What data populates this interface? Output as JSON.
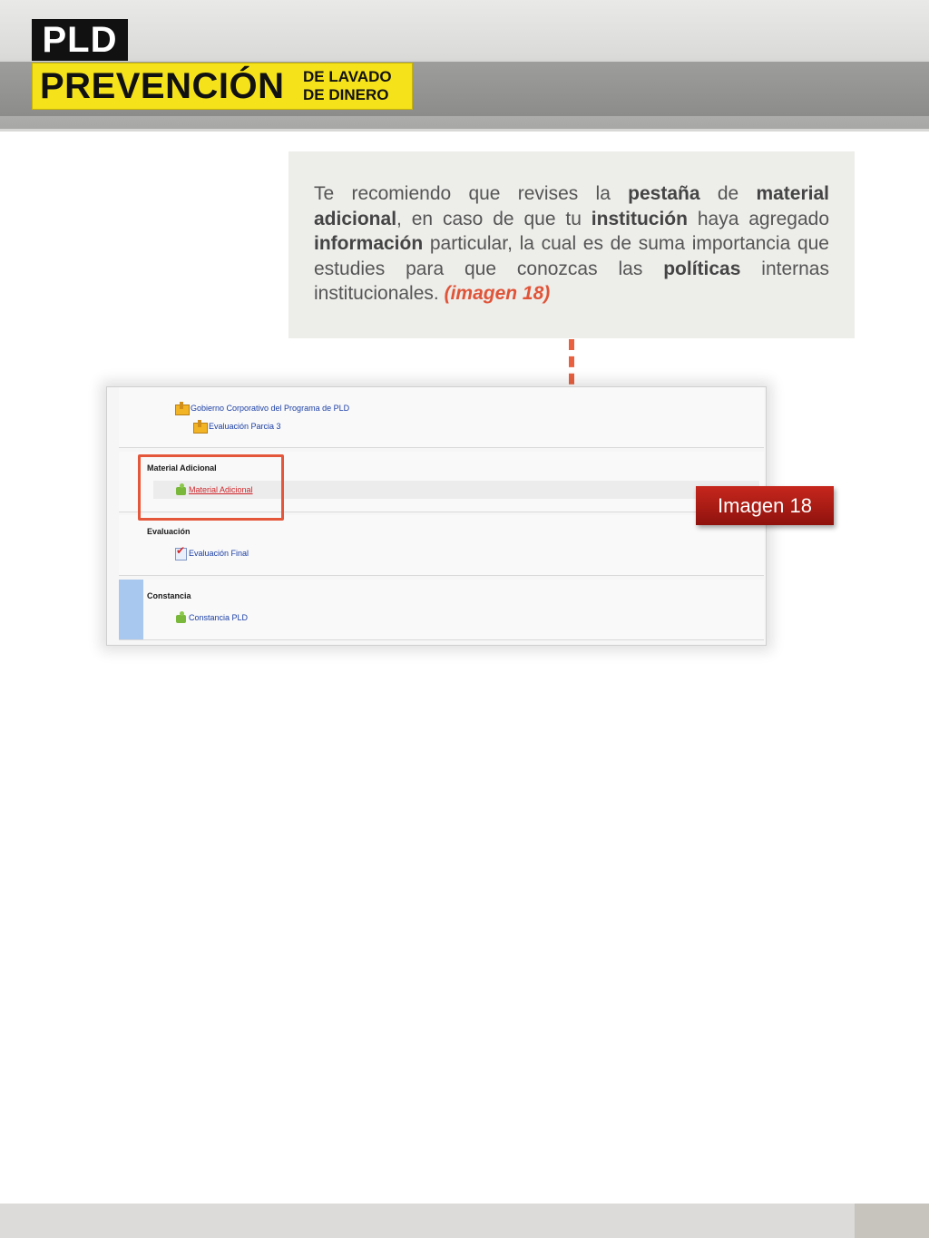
{
  "header": {
    "logo_short": "PLD",
    "logo_main": "PREVENCIÓN",
    "logo_sub1": "DE LAVADO",
    "logo_sub2": "DE DINERO"
  },
  "callout": {
    "t1": "Te recomiendo que revises la ",
    "b1": "pestaña",
    "t2": " de ",
    "b2": "material adicional",
    "t3": ", en caso de que tu ",
    "b3": "institución",
    "t4": " haya agregado ",
    "b4": "información",
    "t5": " particular, la cual es de suma  importancia que estudies para que conozcas las ",
    "b5": "políticas",
    "t6": " internas institucionales. ",
    "ref": "(imagen 18)"
  },
  "screenshot": {
    "sections": [
      {
        "title": "",
        "items": [
          {
            "label": "Gobierno Corporativo del Programa de PLD",
            "icon": "folder-box-icon"
          },
          {
            "label": "Evaluación Parcia  3",
            "icon": "folder-box-icon"
          }
        ]
      },
      {
        "title": "Material Adicional",
        "items": [
          {
            "label": "Material Adicional",
            "icon": "puzzle-icon"
          }
        ]
      },
      {
        "title": "Evaluación",
        "items": [
          {
            "label": "Evaluación Final",
            "icon": "checklist-icon"
          }
        ]
      },
      {
        "title": "Constancia",
        "items": [
          {
            "label": "Constancia PLD",
            "icon": "puzzle-icon"
          }
        ]
      }
    ]
  },
  "image_tag": "Imagen 18",
  "colors": {
    "accent_orange": "#e8603f",
    "tag_red": "#b01d16",
    "logo_yellow": "#f5e21b",
    "link_blue": "#1b3fa5"
  }
}
